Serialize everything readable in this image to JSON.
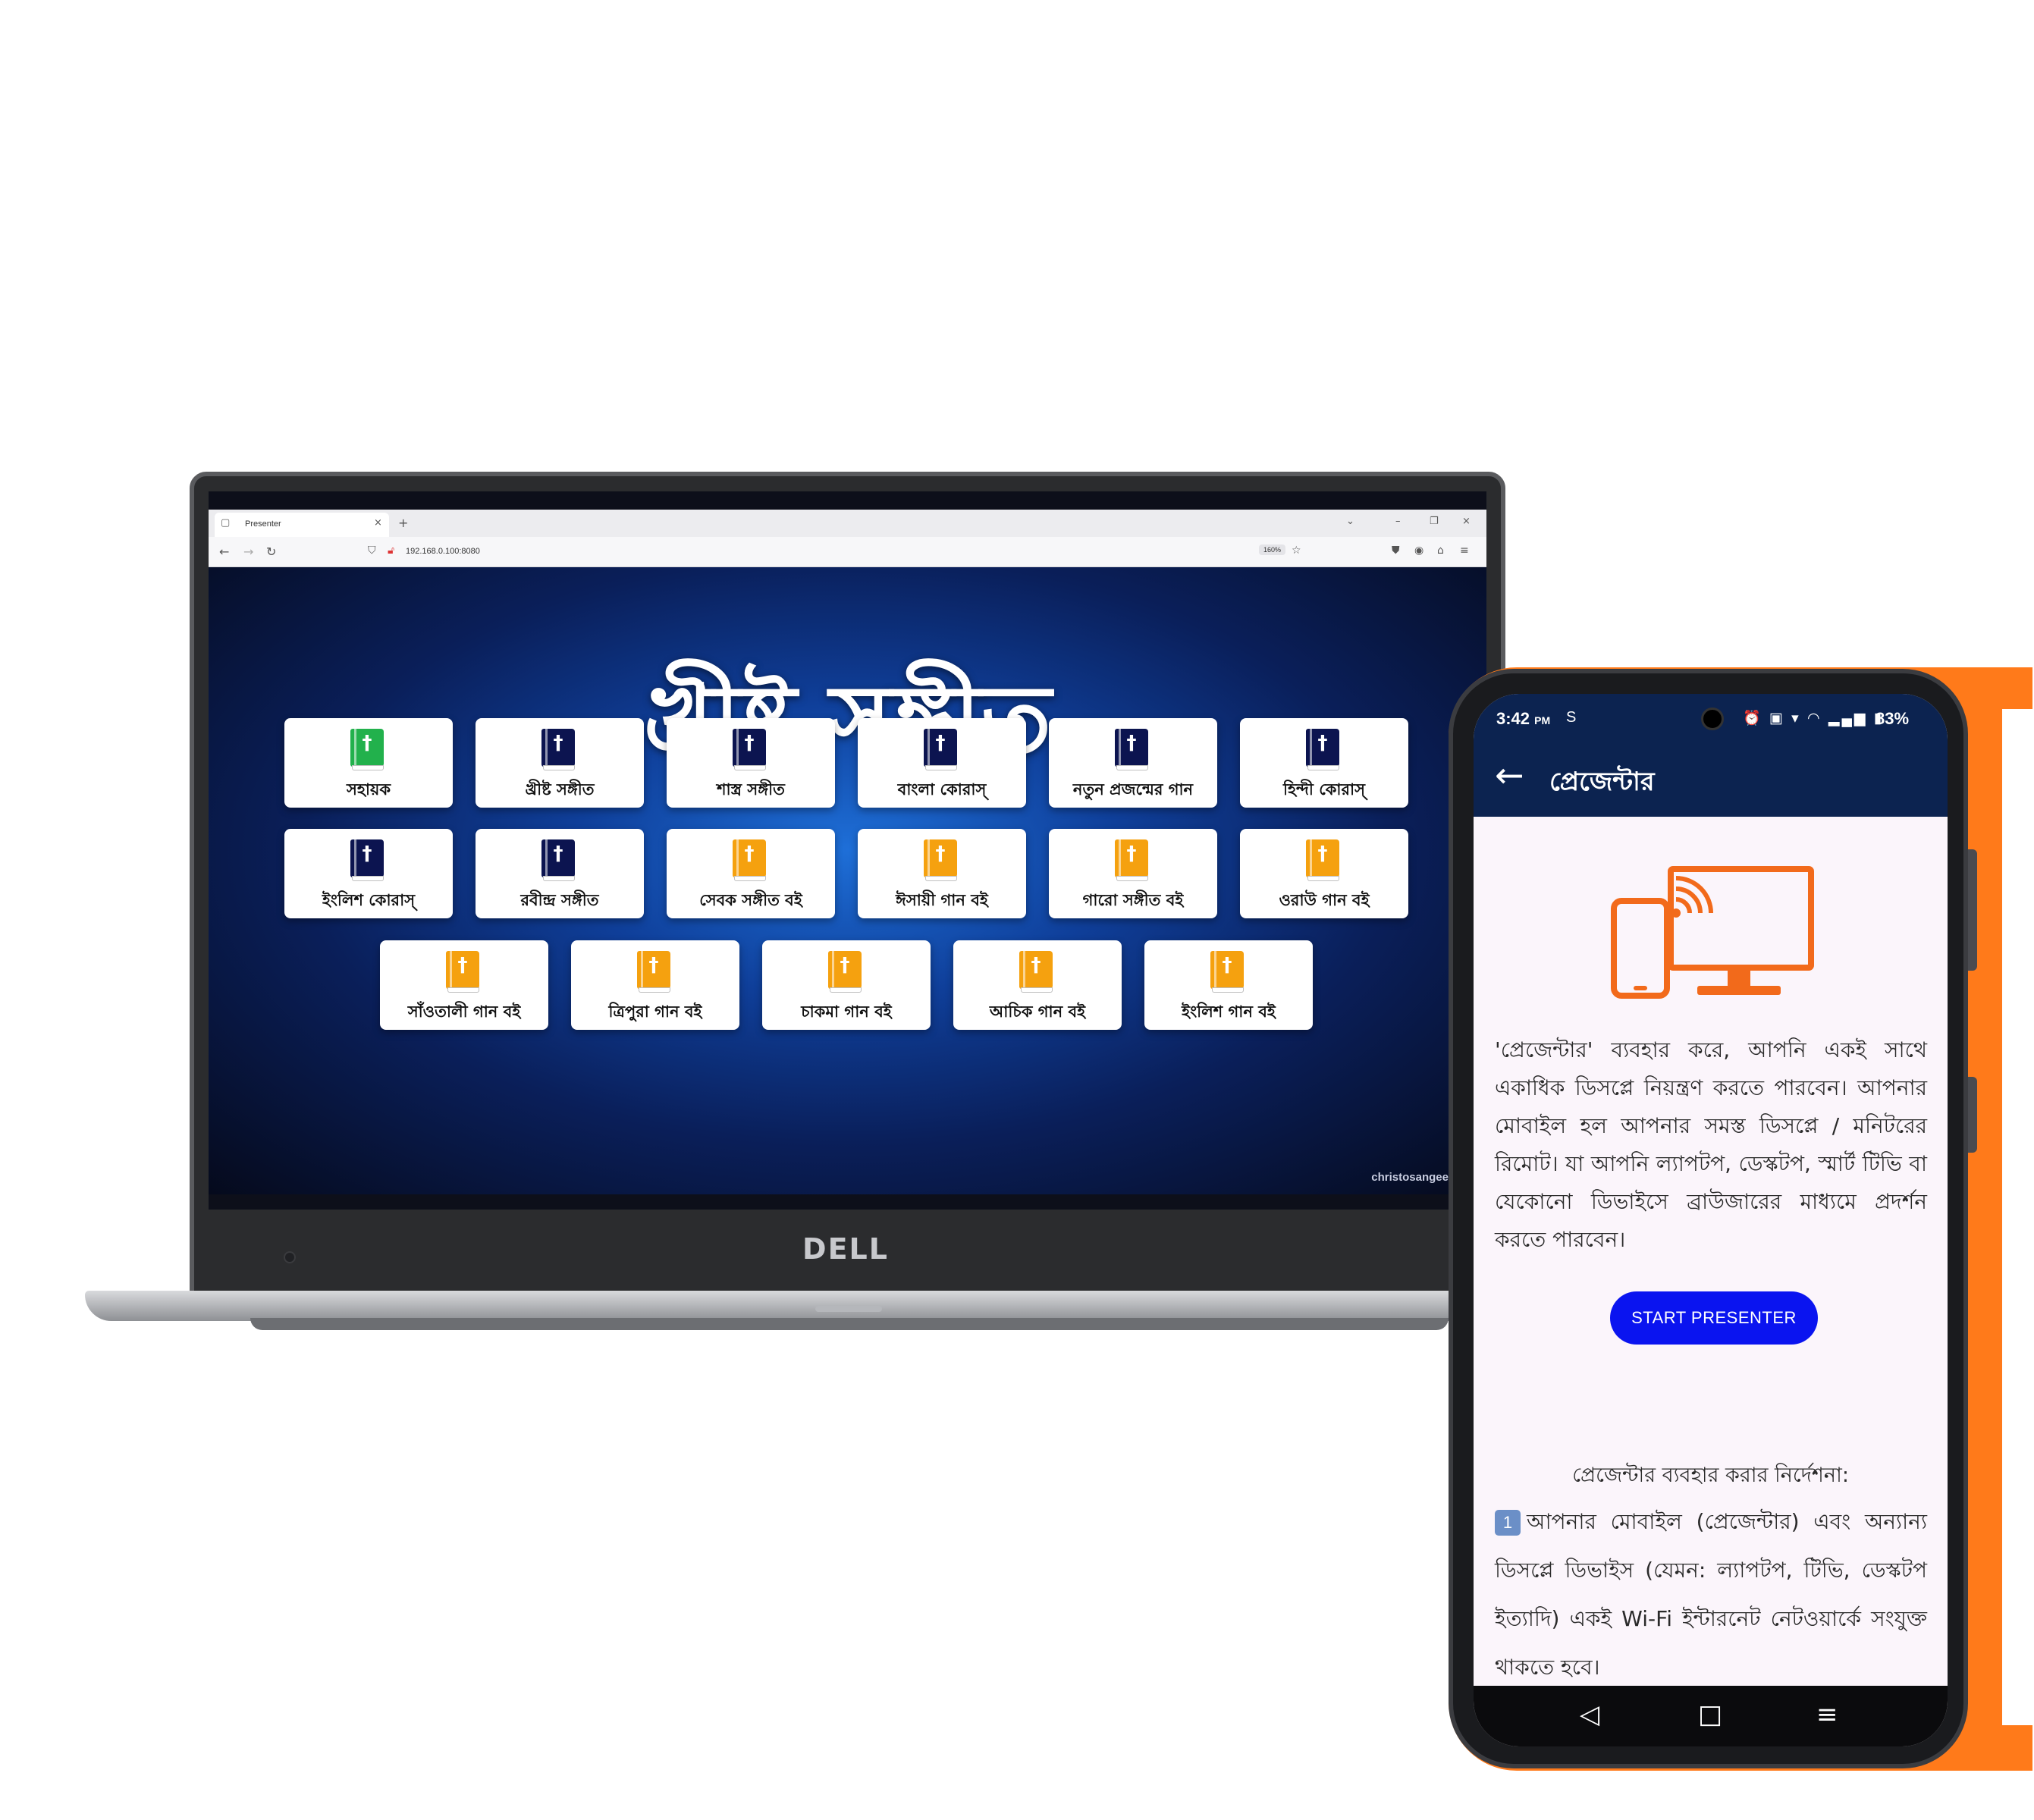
{
  "browser": {
    "tab_title": "Presenter",
    "url": "192.168.0.100:8080",
    "zoom": "160%"
  },
  "presenter_page": {
    "title": "খ্রীষ্ট সঙ্গীত",
    "watermark": "christosangeet.com",
    "cards": [
      {
        "label": "সহায়ক",
        "color": "#22b14c"
      },
      {
        "label": "খ্রীষ্ট সঙ্গীত",
        "color": "#0c1450"
      },
      {
        "label": "শাস্ত্র সঙ্গীত",
        "color": "#0c1450"
      },
      {
        "label": "বাংলা কোরাস্",
        "color": "#0c1450"
      },
      {
        "label": "নতুন প্রজন্মের গান",
        "color": "#0c1450"
      },
      {
        "label": "হিন্দী কোরাস্",
        "color": "#0c1450"
      },
      {
        "label": "ইংলিশ কোরাস্",
        "color": "#0c1450"
      },
      {
        "label": "রবীন্দ্র সঙ্গীত",
        "color": "#0c1450"
      },
      {
        "label": "সেবক সঙ্গীত বই",
        "color": "#f5a10f"
      },
      {
        "label": "ঈসায়ী গান বই",
        "color": "#f5a10f"
      },
      {
        "label": "গারো সঙ্গীত বই",
        "color": "#f5a10f"
      },
      {
        "label": "ওরাউ গান বই",
        "color": "#f5a10f"
      },
      {
        "label": "সাঁওতালী গান বই",
        "color": "#f5a10f"
      },
      {
        "label": "ত্রিপুরা গান বই",
        "color": "#f5a10f"
      },
      {
        "label": "চাকমা গান বই",
        "color": "#f5a10f"
      },
      {
        "label": "আচিক গান বই",
        "color": "#f5a10f"
      },
      {
        "label": "ইংলিশ গান বই",
        "color": "#f5a10f"
      }
    ]
  },
  "laptop": {
    "brand": "DELL"
  },
  "phone": {
    "status": {
      "time": "3:42",
      "ampm": "PM",
      "carrier_icon": "S",
      "battery": "83%"
    },
    "app_title": "প্রেজেন্টার",
    "description": "'প্রেজেন্টার' ব্যবহার করে, আপনি একই সাথে একাধিক ডিসপ্লে নিয়ন্ত্রণ করতে পারবেন। আপনার মোবাইল হল আপনার সমস্ত ডিসপ্লে / মনিটরের রিমোট। যা আপনি ল্যাপটপ, ডেস্কটপ, স্মার্ট টিভি বা যেকোনো ডিভাইসে ব্রাউজারের মাধ্যমে প্রদর্শন করতে পারবেন।",
    "start_button": "START PRESENTER",
    "instructions_title": "প্রেজেন্টার ব্যবহার করার নির্দেশনা:",
    "instruction_1_number": "1",
    "instruction_1": "আপনার মোবাইল (প্রেজেন্টার) এবং অন্যান্য ডিসপ্লে ডিভাইস (যেমন: ল্যাপটপ, টিভি, ডেস্কটপ ইত্যাদি) একই Wi-Fi ইন্টারনেট নেটওয়ার্কে সংযুক্ত থাকতে হবে।",
    "accent_color": "#f26a1b",
    "header_color": "#0c2350"
  }
}
